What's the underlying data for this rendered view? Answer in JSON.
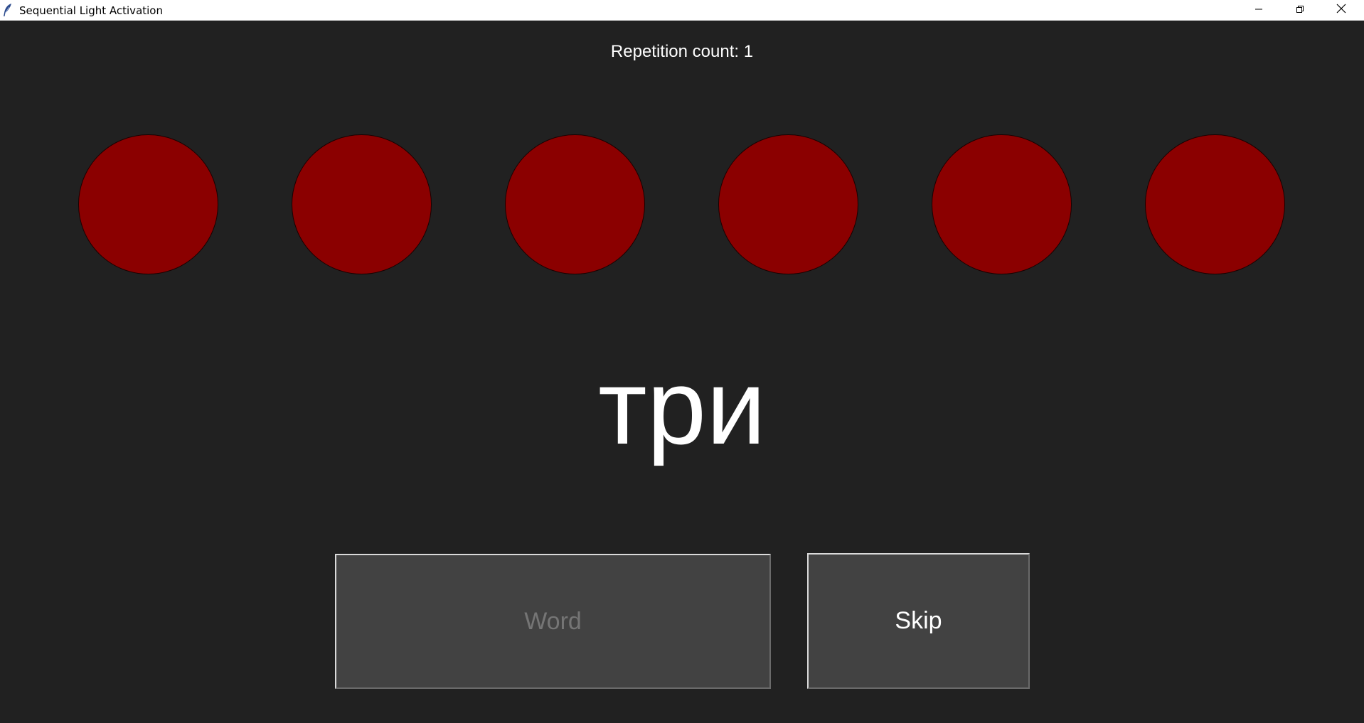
{
  "window": {
    "title": "Sequential Light Activation",
    "app_icon": "feather-icon",
    "controls": [
      "minimize-icon",
      "restore-icon",
      "close-icon"
    ]
  },
  "repetition": {
    "text": "Repetition count: 1"
  },
  "lights": {
    "count": 6,
    "color": "#8b0000",
    "state": [
      "off",
      "off",
      "off",
      "off",
      "off",
      "off"
    ]
  },
  "word": {
    "text": "три"
  },
  "buttons": {
    "word_label": "Word",
    "word_enabled": false,
    "skip_label": "Skip",
    "skip_enabled": true
  },
  "colors": {
    "background": "#212121",
    "button": "#424242",
    "light_off": "#8b0000",
    "text": "#ffffff",
    "disabled_text": "#757575"
  }
}
